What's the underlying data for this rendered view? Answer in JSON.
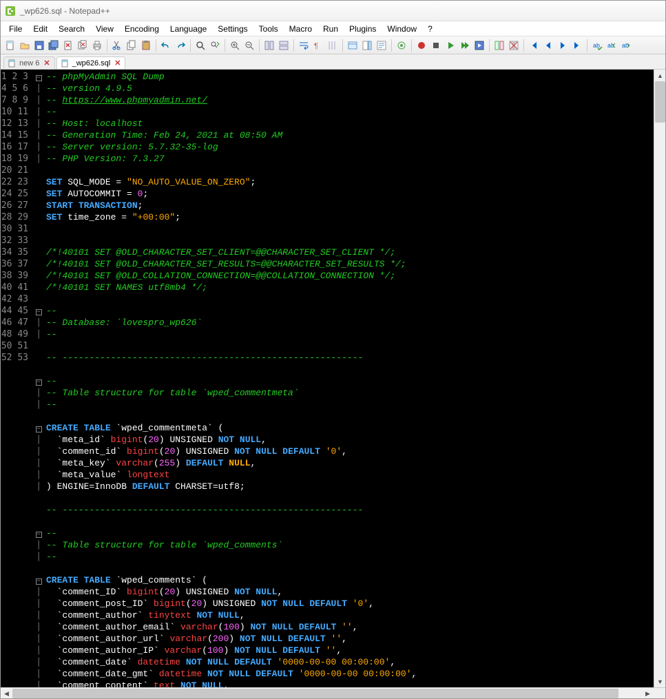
{
  "titlebar": {
    "text": "_wp626.sql - Notepad++"
  },
  "menu": {
    "file": "File",
    "edit": "Edit",
    "search": "Search",
    "view": "View",
    "encoding": "Encoding",
    "language": "Language",
    "settings": "Settings",
    "tools": "Tools",
    "macro": "Macro",
    "run": "Run",
    "plugins": "Plugins",
    "window": "Window",
    "help": "?"
  },
  "tabs": {
    "t1": {
      "label": "new 6",
      "close": "✕"
    },
    "t2": {
      "label": "_wp626.sql",
      "close": "✕"
    }
  },
  "gutter": "1\n2\n3\n4\n5\n6\n7\n8\n9\n10\n11\n12\n13\n14\n15\n16\n17\n18\n19\n20\n21\n22\n23\n24\n25\n26\n27\n28\n29\n30\n31\n32\n33\n34\n35\n36\n37\n38\n39\n40\n41\n42\n43\n44\n45\n46\n47\n48\n49\n50\n51\n52\n53",
  "code": {
    "l1": "-- phpMyAdmin SQL Dump",
    "l2": "-- version 4.9.5",
    "l3a": "-- ",
    "l3b": "https://www.phpmyadmin.net/",
    "l4": "--",
    "l5": "-- Host: localhost",
    "l6": "-- Generation Time: Feb 24, 2021 at 08:50 AM",
    "l7": "-- Server version: 5.7.32-35-log",
    "l8": "-- PHP Version: 7.3.27",
    "l10_set": "SET",
    "l10_id": " SQL_MODE ",
    "l10_eq": "=",
    "l10_str": " \"NO_AUTO_VALUE_ON_ZERO\"",
    "l10_sc": ";",
    "l11_set": "SET",
    "l11_id": " AUTOCOMMIT ",
    "l11_eq": "=",
    "l11_num": " 0",
    "l11_sc": ";",
    "l12_a": "START",
    "l12_b": " TRANSACTION",
    "l12_sc": ";",
    "l13_set": "SET",
    "l13_id": " time_zone ",
    "l13_eq": "=",
    "l13_str": " \"+00:00\"",
    "l13_sc": ";",
    "l16": "/*!40101 SET @OLD_CHARACTER_SET_CLIENT=@@CHARACTER_SET_CLIENT */;",
    "l17": "/*!40101 SET @OLD_CHARACTER_SET_RESULTS=@@CHARACTER_SET_RESULTS */;",
    "l18": "/*!40101 SET @OLD_COLLATION_CONNECTION=@@COLLATION_CONNECTION */;",
    "l19": "/*!40101 SET NAMES utf8mb4 */;",
    "l21": "--",
    "l22": "-- Database: `lovespro_wp626`",
    "l23": "--",
    "l25": "-- --------------------------------------------------------",
    "l27": "--",
    "l28": "-- Table structure for table `wped_commentmeta`",
    "l29": "--",
    "l31_a": "CREATE",
    "l31_b": " TABLE",
    "l31_c": " `wped_commentmeta`",
    "l31_d": " (",
    "l32_a": "  `meta_id`",
    "l32_b": " bigint",
    "l32_c": "(",
    "l32_d": "20",
    "l32_e": ")",
    "l32_f": " UNSIGNED ",
    "l32_g": "NOT NULL",
    "l32_h": ",",
    "l33_a": "  `comment_id`",
    "l33_b": " bigint",
    "l33_c": "(",
    "l33_d": "20",
    "l33_e": ")",
    "l33_f": " UNSIGNED ",
    "l33_g": "NOT NULL",
    "l33_h": " DEFAULT ",
    "l33_i": "'0'",
    "l33_j": ",",
    "l34_a": "  `meta_key`",
    "l34_b": " varchar",
    "l34_c": "(",
    "l34_d": "255",
    "l34_e": ")",
    "l34_f": " DEFAULT ",
    "l34_g": "NULL",
    "l34_h": ",",
    "l35_a": "  `meta_value`",
    "l35_b": " longtext",
    "l36_a": ")",
    "l36_b": " ENGINE",
    "l36_c": "=InnoDB ",
    "l36_d": "DEFAULT",
    "l36_e": " CHARSET",
    "l36_f": "=utf8",
    "l36_g": ";",
    "l38": "-- --------------------------------------------------------",
    "l40": "--",
    "l41": "-- Table structure for table `wped_comments`",
    "l42": "--",
    "l44_a": "CREATE",
    "l44_b": " TABLE",
    "l44_c": " `wped_comments`",
    "l44_d": " (",
    "l45_a": "  `comment_ID`",
    "l45_b": " bigint",
    "l45_c": "(",
    "l45_d": "20",
    "l45_e": ")",
    "l45_f": " UNSIGNED ",
    "l45_g": "NOT NULL",
    "l45_h": ",",
    "l46_a": "  `comment_post_ID`",
    "l46_b": " bigint",
    "l46_c": "(",
    "l46_d": "20",
    "l46_e": ")",
    "l46_f": " UNSIGNED ",
    "l46_g": "NOT NULL",
    "l46_h": " DEFAULT ",
    "l46_i": "'0'",
    "l46_j": ",",
    "l47_a": "  `comment_author`",
    "l47_b": " tinytext",
    "l47_c": " NOT NULL",
    "l47_d": ",",
    "l48_a": "  `comment_author_email`",
    "l48_b": " varchar",
    "l48_c": "(",
    "l48_d": "100",
    "l48_e": ")",
    "l48_f": " NOT NULL",
    "l48_g": " DEFAULT ",
    "l48_h": "''",
    "l48_i": ",",
    "l49_a": "  `comment_author_url`",
    "l49_b": " varchar",
    "l49_c": "(",
    "l49_d": "200",
    "l49_e": ")",
    "l49_f": " NOT NULL",
    "l49_g": " DEFAULT ",
    "l49_h": "''",
    "l49_i": ",",
    "l50_a": "  `comment_author_IP`",
    "l50_b": " varchar",
    "l50_c": "(",
    "l50_d": "100",
    "l50_e": ")",
    "l50_f": " NOT NULL",
    "l50_g": " DEFAULT ",
    "l50_h": "''",
    "l50_i": ",",
    "l51_a": "  `comment_date`",
    "l51_b": " datetime",
    "l51_c": " NOT NULL",
    "l51_d": " DEFAULT ",
    "l51_e": "'0000-00-00 00:00:00'",
    "l51_f": ",",
    "l52_a": "  `comment_date_gmt`",
    "l52_b": " datetime",
    "l52_c": " NOT NULL",
    "l52_d": " DEFAULT ",
    "l52_e": "'0000-00-00 00:00:00'",
    "l52_f": ",",
    "l53_a": "  `comment_content`",
    "l53_b": " text",
    "l53_c": " NOT NULL",
    "l53_d": ","
  }
}
